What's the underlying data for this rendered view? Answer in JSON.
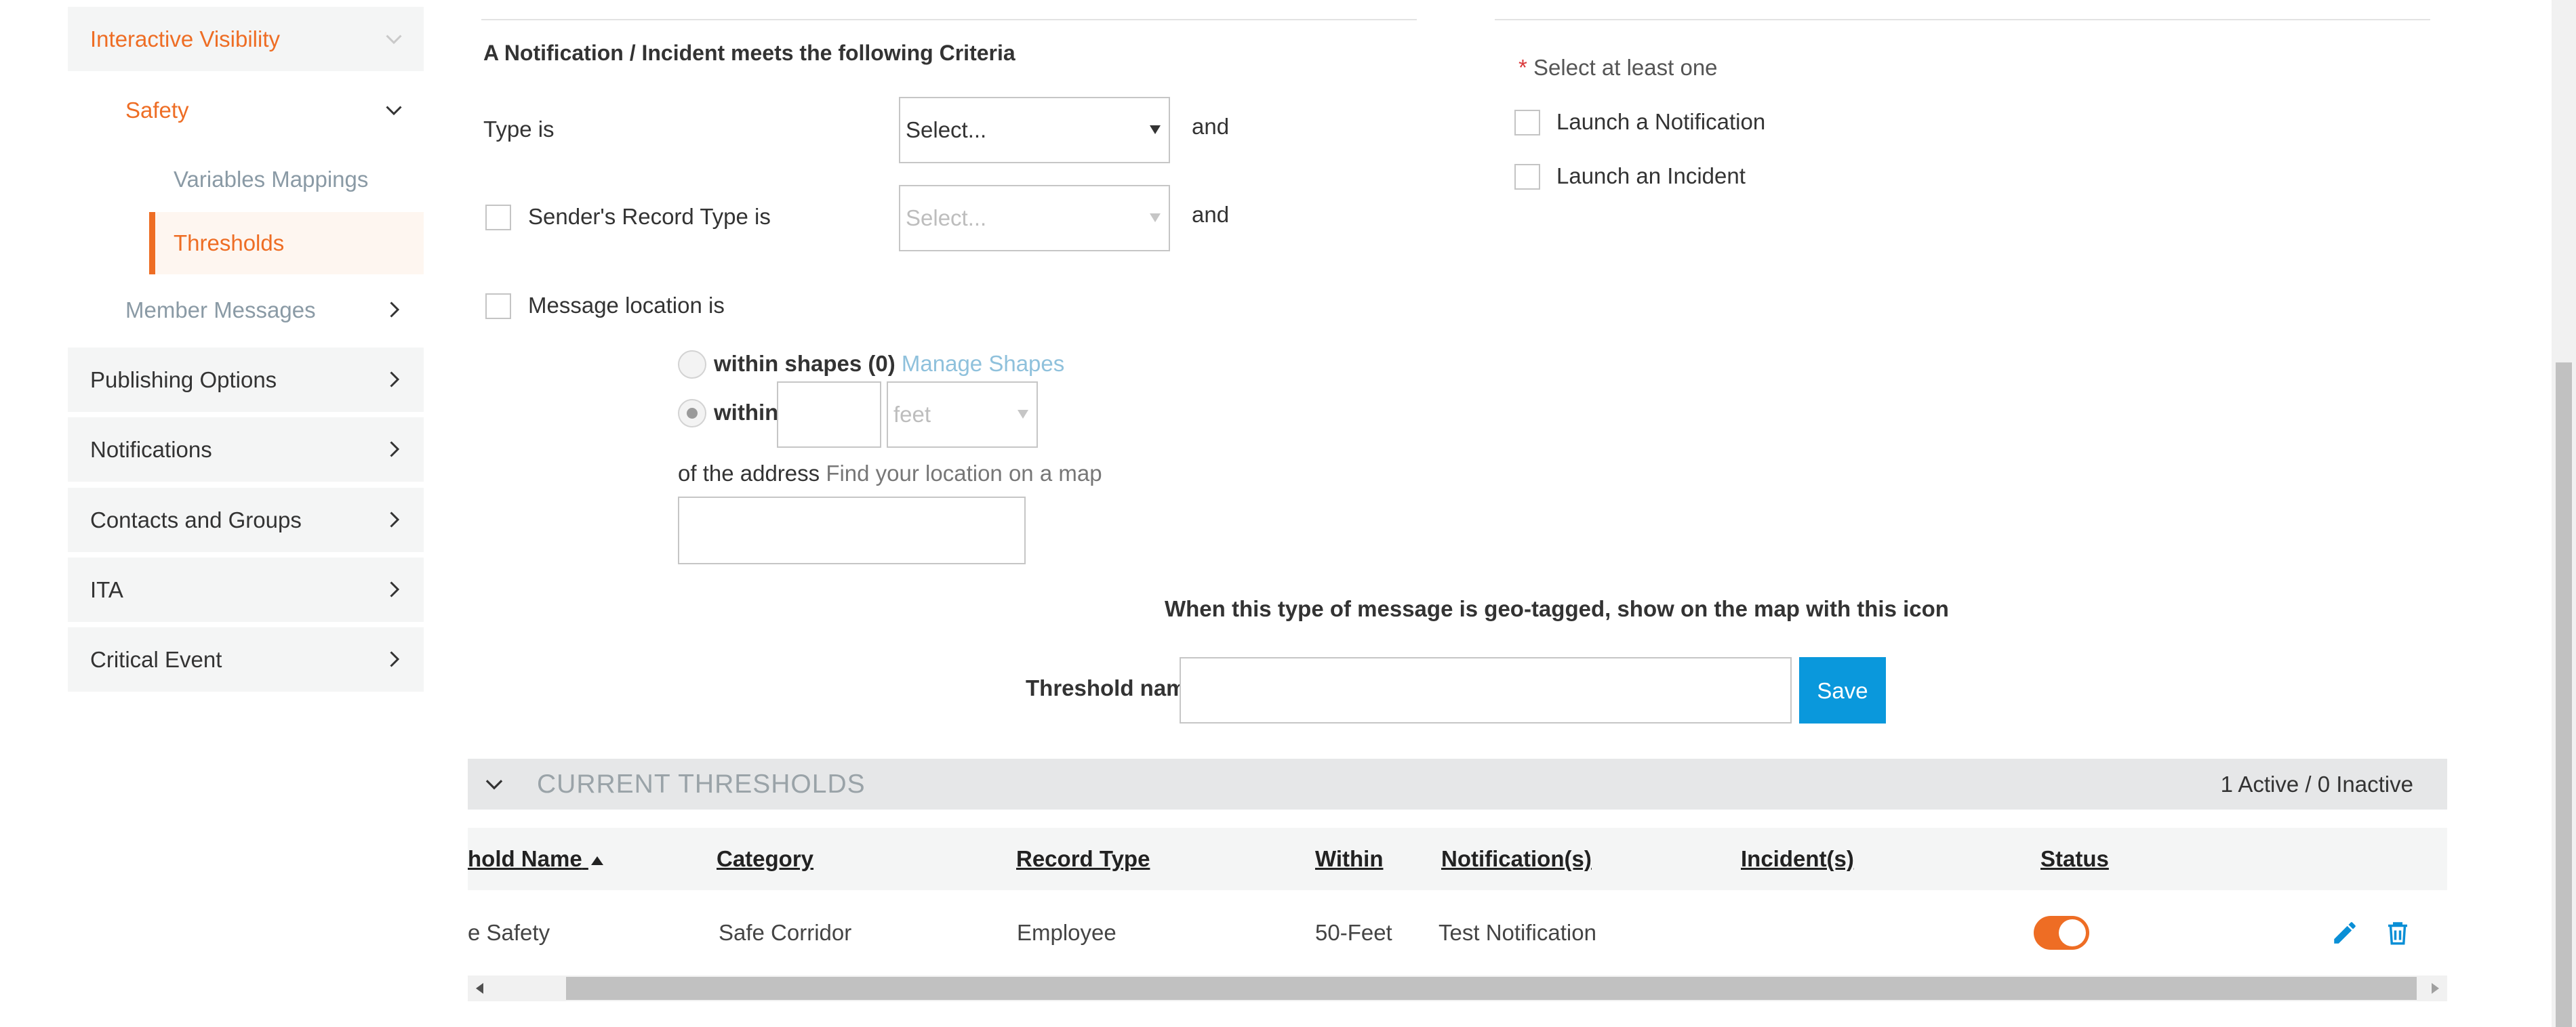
{
  "sidebar": {
    "interactive_visibility": "Interactive Visibility",
    "safety": "Safety",
    "variables_mappings": "Variables Mappings",
    "thresholds": "Thresholds",
    "member_messages": "Member Messages",
    "items": [
      {
        "label": "Publishing Options"
      },
      {
        "label": "Notifications"
      },
      {
        "label": "Contacts and Groups"
      },
      {
        "label": "ITA"
      },
      {
        "label": "Critical Event"
      }
    ]
  },
  "criteria": {
    "heading": "A Notification / Incident meets the following Criteria",
    "type_label": "Type is",
    "type_select": "Select...",
    "and": "and",
    "sender_record_type_label": "Sender's Record Type is",
    "sender_select": "Select...",
    "message_location_label": "Message location is",
    "within_shapes": "within shapes",
    "shapes_count": "(0)",
    "manage_shapes": "Manage Shapes",
    "within": "within",
    "unit_select": "feet",
    "of_the_address": "of the address",
    "find_location": "Find your location on a map",
    "geo_tag_text": "When this type of message is geo-tagged, show on the map with this icon",
    "threshold_name_label": "Threshold name",
    "save": "Save"
  },
  "launch": {
    "required_mark": "*",
    "select_at_least_one": "Select at least one",
    "launch_notification": "Launch a Notification",
    "launch_incident": "Launch an Incident"
  },
  "thresholds": {
    "title": "CURRENT THRESHOLDS",
    "count": "1 Active / 0 Inactive",
    "columns": {
      "name": "hold Name",
      "category": "Category",
      "record_type": "Record Type",
      "within": "Within",
      "notifications": "Notification(s)",
      "incidents": "Incident(s)",
      "status": "Status"
    },
    "rows": [
      {
        "name": "e Safety",
        "category": "Safe Corridor",
        "record_type": "Employee",
        "within": "50-Feet",
        "notifications": "Test Notification",
        "incidents": "",
        "status_active": true
      }
    ]
  },
  "colors": {
    "accent_orange": "#ee6d24",
    "primary_blue": "#0a98dc",
    "link_blue": "#8fc1dc"
  }
}
